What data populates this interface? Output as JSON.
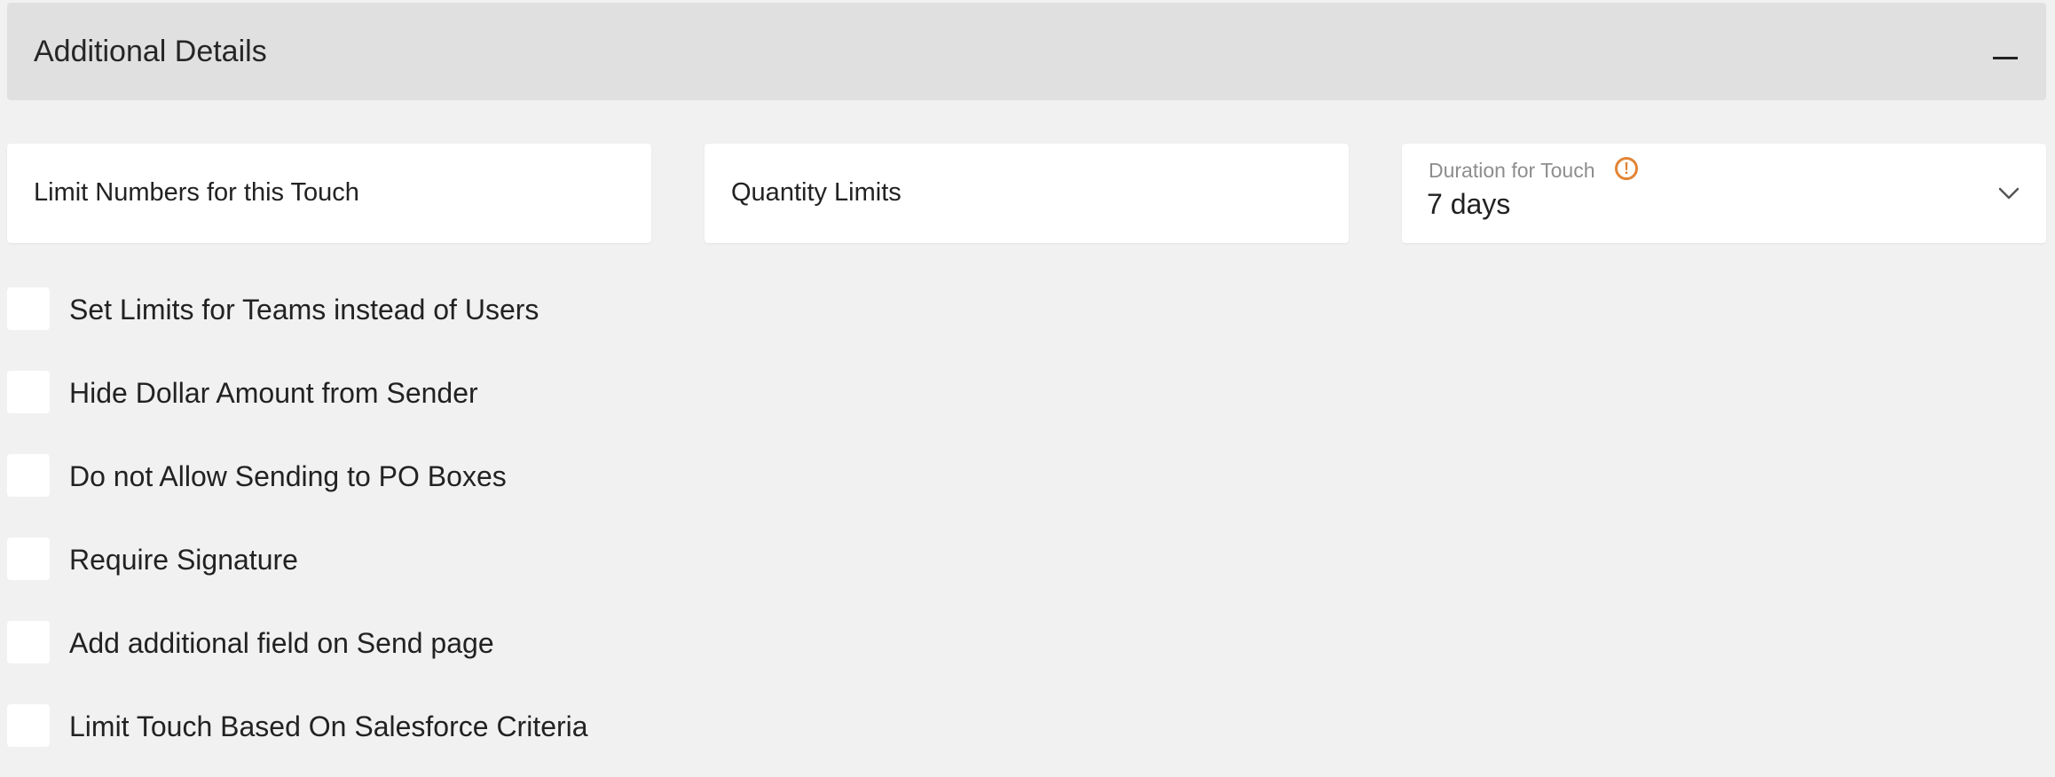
{
  "section": {
    "title": "Additional Details",
    "collapse_icon": "minus-icon"
  },
  "fields": {
    "limit_numbers": {
      "label": "Limit Numbers for this Touch"
    },
    "quantity_limits": {
      "label": "Quantity Limits"
    },
    "duration": {
      "label": "Duration for Touch",
      "value": "7 days",
      "info_icon": "!",
      "info_color": "#e38435",
      "dropdown_icon": "chevron-down-icon"
    }
  },
  "checkboxes": [
    {
      "label": "Set Limits for Teams instead of Users",
      "checked": false
    },
    {
      "label": "Hide Dollar Amount from Sender",
      "checked": false
    },
    {
      "label": "Do not Allow Sending to PO Boxes",
      "checked": false
    },
    {
      "label": "Require Signature",
      "checked": false
    },
    {
      "label": "Add additional field on Send page",
      "checked": false
    },
    {
      "label": "Limit Touch Based On Salesforce Criteria",
      "checked": false
    }
  ]
}
